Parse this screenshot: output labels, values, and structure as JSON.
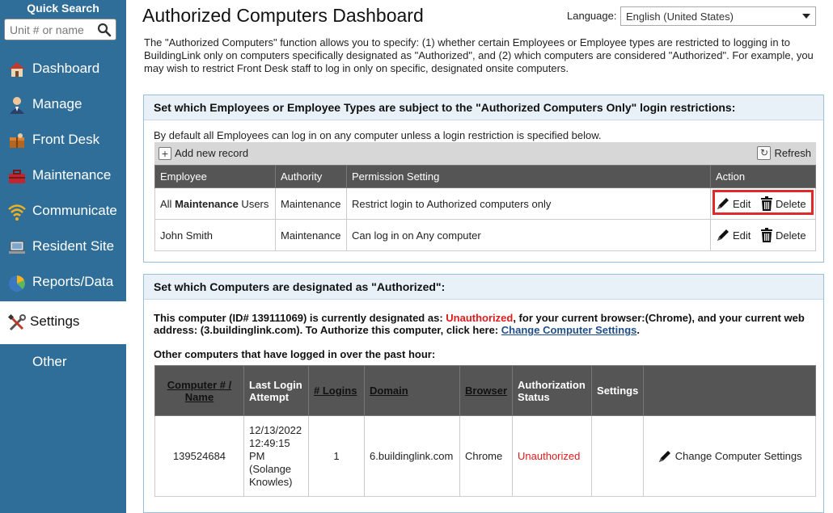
{
  "sidebar": {
    "quick_search_label": "Quick Search",
    "search_placeholder": "Unit # or name",
    "items": [
      {
        "label": "Dashboard",
        "icon": "house-icon"
      },
      {
        "label": "Manage",
        "icon": "person-icon"
      },
      {
        "label": "Front Desk",
        "icon": "package-icon"
      },
      {
        "label": "Maintenance",
        "icon": "toolbox-icon"
      },
      {
        "label": "Communicate",
        "icon": "wifi-icon"
      },
      {
        "label": "Resident Site",
        "icon": "laptop-icon"
      },
      {
        "label": "Reports/Data",
        "icon": "pie-chart-icon"
      },
      {
        "label": "Settings",
        "icon": "tools-icon"
      },
      {
        "label": "Other",
        "icon": ""
      }
    ],
    "active_index": 7
  },
  "header": {
    "title": "Authorized Computers Dashboard",
    "language_label": "Language:",
    "language_value": "English (United States)"
  },
  "intro": "The \"Authorized Computers\" function allows you to specify: (1) whether certain Employees or Employee types are restricted to logging in to BuildingLink only on computers specifically designated as \"Authorized\", and (2) which computers are considered \"Authorized\". For example, you may wish to restrict Front Desk staff to log in only on specific, designated onsite computers.",
  "panel1": {
    "title": "Set which Employees or Employee Types are subject to the \"Authorized Computers Only\" login restrictions:",
    "default_note": "By default all Employees can log in on any computer unless a login restriction is specified below.",
    "add_label": "Add new record",
    "refresh_label": "Refresh",
    "columns": [
      "Employee",
      "Authority",
      "Permission Setting",
      "Action"
    ],
    "rows": [
      {
        "employee_prefix": "All ",
        "employee_bold": "Maintenance",
        "employee_suffix": " Users",
        "authority": "Maintenance",
        "permission": "Restrict login to Authorized computers only",
        "edit": "Edit",
        "delete": "Delete"
      },
      {
        "employee_prefix": "John Smith",
        "employee_bold": "",
        "employee_suffix": "",
        "authority": "Maintenance",
        "permission": "Can log in on Any computer",
        "edit": "Edit",
        "delete": "Delete"
      }
    ]
  },
  "panel2": {
    "title": "Set which Computers are designated as \"Authorized\":",
    "this_computer_pre": "This computer (ID# 139111069) is currently designated as: ",
    "this_computer_status": "Unauthorized",
    "this_computer_mid": ", for your current browser:(Chrome), and your current web address: (3.buildinglink.com). To Authorize this computer, click here: ",
    "this_computer_link": "Change Computer Settings",
    "this_computer_end": ".",
    "other_label": "Other computers that have logged in over the past hour:",
    "columns": [
      "Computer # / Name",
      "Last Login Attempt",
      "# Logins",
      "Domain",
      "Browser",
      "Authorization Status",
      "Settings",
      ""
    ],
    "rows": [
      {
        "computer": "139524684",
        "last_login": "12/13/2022 12:49:15 PM (Solange Knowles)",
        "logins": "1",
        "domain": "6.buildinglink.com",
        "browser": "Chrome",
        "status": "Unauthorized",
        "settings": "",
        "action": "Change Computer Settings"
      }
    ]
  }
}
